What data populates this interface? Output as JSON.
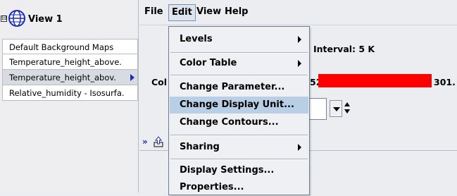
{
  "view": {
    "title": "View 1",
    "expander_glyph": "⊟"
  },
  "layers": [
    {
      "label": "Default Background Maps"
    },
    {
      "label": "Temperature_height_above."
    },
    {
      "label": "Temperature_height_abov."
    },
    {
      "label": "Relative_humidity - Isosurfa."
    }
  ],
  "menubar": {
    "file": "File",
    "edit": "Edit",
    "view": "View",
    "help": "Help"
  },
  "edit_menu": {
    "levels": "Levels",
    "color_table": "Color Table",
    "change_parameter": "Change Parameter...",
    "change_display_unit": "Change Display Unit...",
    "change_contours": "Change Contours...",
    "sharing": "Sharing",
    "display_settings": "Display Settings...",
    "properties": "Properties..."
  },
  "content": {
    "interval": "Interval: 5 K",
    "color_label": "Col",
    "range_min": "52",
    "range_max": "301.",
    "color_bar_color": "#ff0000"
  },
  "toolbar": {
    "chevrons": "»"
  },
  "colors": {
    "menu_highlight": "#b8cfe5",
    "arrow_blue": "#1b2ab8"
  }
}
